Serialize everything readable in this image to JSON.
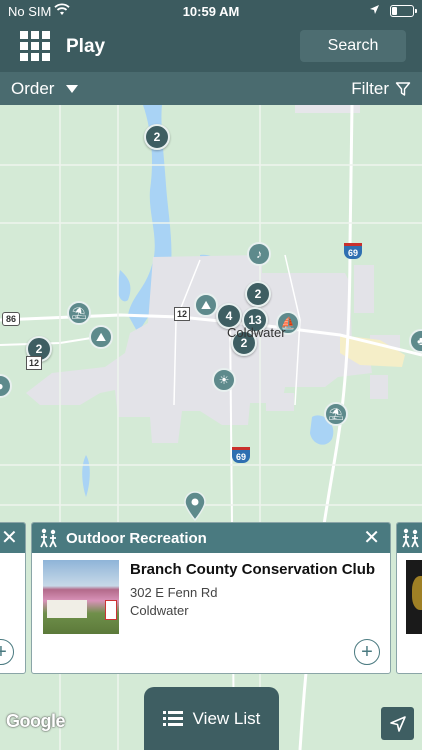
{
  "status_bar": {
    "carrier": "No SIM",
    "time": "10:59 AM",
    "battery_level": 0.25
  },
  "header": {
    "title": "Play",
    "search_label": "Search",
    "menu_icon": "grid-menu-icon"
  },
  "toolbar": {
    "order_label": "Order",
    "filter_label": "Filter"
  },
  "map": {
    "clusters": [
      "2",
      "2",
      "4",
      "13",
      "2",
      "2"
    ],
    "town_label": "Coldwater",
    "route_shields": [
      "86",
      "12",
      "12",
      "69",
      "69"
    ]
  },
  "cards": {
    "main": {
      "category": "Outdoor Recreation",
      "name": "Branch County Conservation Club",
      "address": "302 E Fenn Rd",
      "city": "Coldwater"
    }
  },
  "footer": {
    "view_list_label": "View List",
    "google_label": "Google"
  },
  "colors": {
    "header": "#3c5b5f",
    "subbar": "#4a6b6f",
    "card_header": "#4a7a80",
    "map_land": "#d4ead6",
    "map_water": "#a9d3f5",
    "map_urban": "#e3e3e8"
  }
}
